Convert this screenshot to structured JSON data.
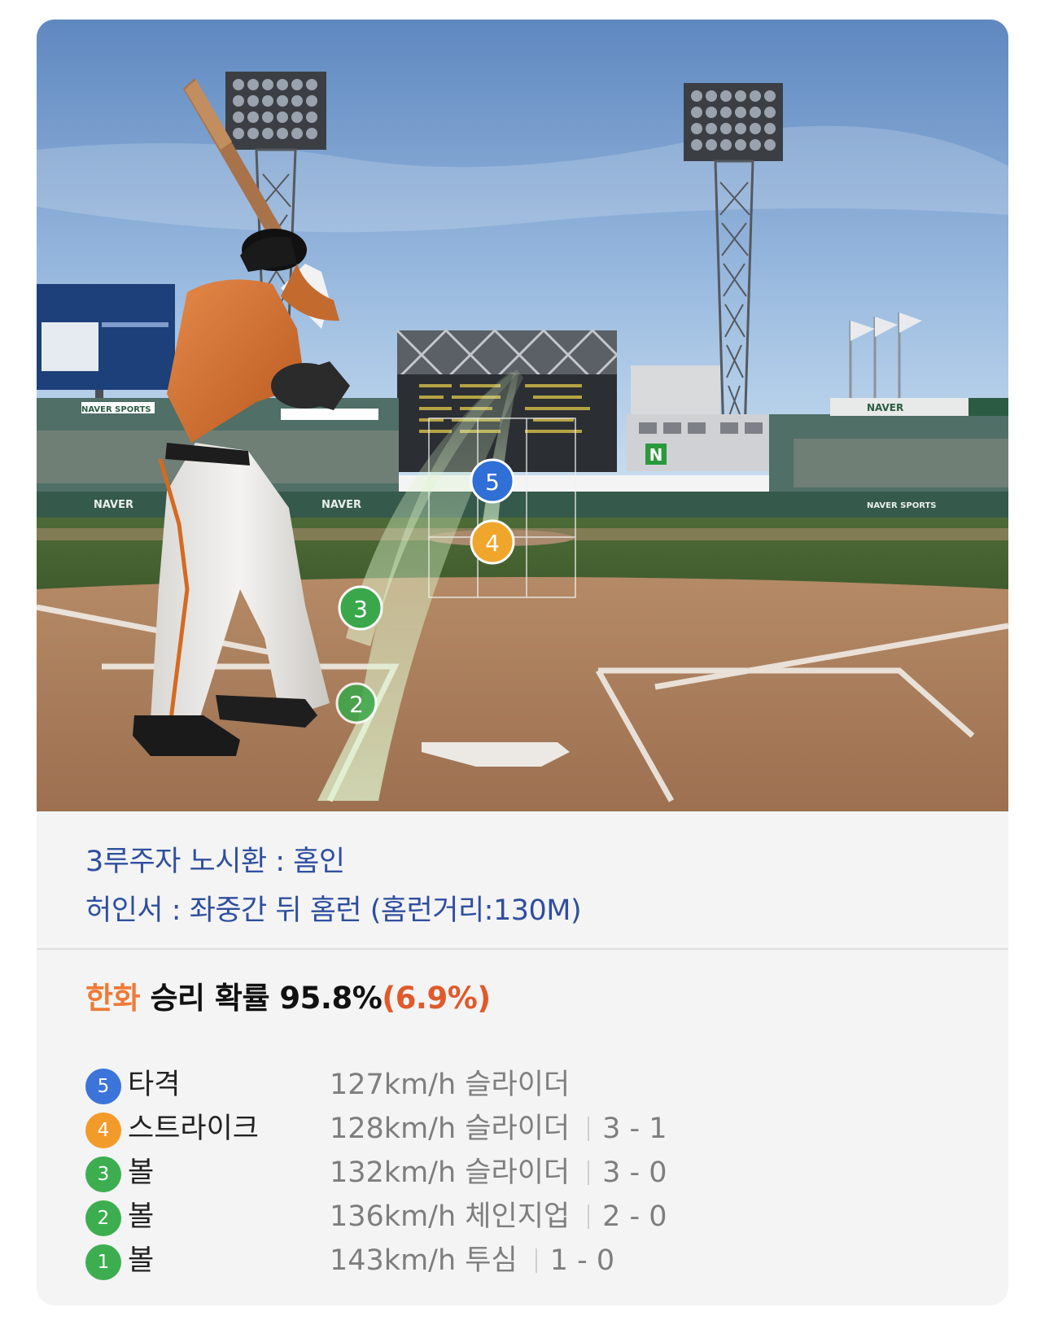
{
  "scene": {
    "billboards": [
      "NAVER",
      "NAVER SPORTS",
      "NAVER",
      "NAVER SPORTS",
      "NAVER"
    ],
    "scoreboard_badge": "N",
    "markers": [
      {
        "number": "5",
        "color": "#2f6fd6"
      },
      {
        "number": "4",
        "color": "#f0a52b"
      },
      {
        "number": "3",
        "color": "#3aa84a"
      },
      {
        "number": "2",
        "color": "#3aa84a"
      }
    ]
  },
  "events": [
    {
      "text": "3루주자 노시환 : 홈인"
    },
    {
      "text": "허인서 : 좌중간 뒤 홈런 (홈런거리:130M)"
    }
  ],
  "win_probability": {
    "team": "한화",
    "label": " 승리 확률 ",
    "value": "95.8%",
    "change": "(6.9%)"
  },
  "pitches": [
    {
      "number": "5",
      "color": "#3c74d9",
      "result": "타격",
      "speed": "127km/h",
      "type": "슬라이더",
      "count": ""
    },
    {
      "number": "4",
      "color": "#f39b2a",
      "result": "스트라이크",
      "speed": "128km/h",
      "type": "슬라이더",
      "count": "3 - 1"
    },
    {
      "number": "3",
      "color": "#3dae4f",
      "result": "볼",
      "speed": "132km/h",
      "type": "슬라이더",
      "count": "3 - 0"
    },
    {
      "number": "2",
      "color": "#3dae4f",
      "result": "볼",
      "speed": "136km/h",
      "type": "체인지업",
      "count": "2 - 0"
    },
    {
      "number": "1",
      "color": "#3dae4f",
      "result": "볼",
      "speed": "143km/h",
      "type": "투심",
      "count": "1 - 0"
    }
  ]
}
